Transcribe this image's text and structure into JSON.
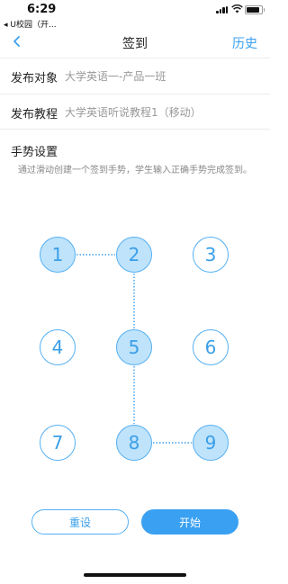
{
  "status_bar": {
    "time": "6:29",
    "back_app": "◂ U校园（开..."
  },
  "nav": {
    "title": "签到",
    "history_label": "历史"
  },
  "form": {
    "target_label": "发布对象",
    "target_value": "大学英语一-产品一班",
    "course_label": "发布教程",
    "course_value": "大学英语听说教程1（移动）"
  },
  "gesture": {
    "section_title": "手势设置",
    "hint": "通过滑动创建一个签到手势，学生输入正确手势完成签到。",
    "nodes": [
      "1",
      "2",
      "3",
      "4",
      "5",
      "6",
      "7",
      "8",
      "9"
    ],
    "selected_sequence": [
      "1",
      "2",
      "5",
      "8",
      "9"
    ]
  },
  "buttons": {
    "reset_label": "重设",
    "start_label": "开始"
  },
  "colors": {
    "accent": "#3aa0f2",
    "node_active": "#bfe3fb"
  },
  "icons": {
    "back": "chevron-left-icon"
  }
}
